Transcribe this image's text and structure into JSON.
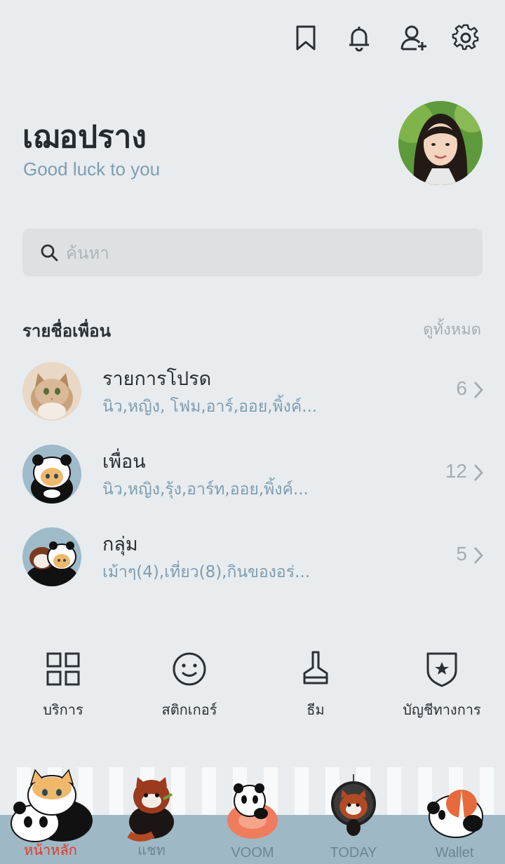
{
  "header": {
    "icons": [
      "bookmark-icon",
      "bell-icon",
      "add-friend-icon",
      "gear-icon"
    ]
  },
  "profile": {
    "name": "เฌอปราง",
    "status": "Good luck to you"
  },
  "search": {
    "placeholder": "ค้นหา"
  },
  "friends_section": {
    "heading": "รายชื่อเพื่อน",
    "see_all": "ดูทั้งหมด",
    "rows": [
      {
        "title": "รายการโปรด",
        "subtitle": "นิว,หญิง, โฟม,อาร์,ออย,พิ้งค์...",
        "count": "6"
      },
      {
        "title": "เพื่อน",
        "subtitle": "นิว,หญิง,รุ้ง,อาร์ท,ออย,พิ้งค์...",
        "count": "12"
      },
      {
        "title": "กลุ่ม",
        "subtitle": "เม้าๆ(4),เที่ยว(8),กินของอร่...",
        "count": "5"
      }
    ]
  },
  "services": [
    {
      "label": "บริการ",
      "icon": "grid-icon"
    },
    {
      "label": "สติกเกอร์",
      "icon": "smiley-icon"
    },
    {
      "label": "ธีม",
      "icon": "brush-icon"
    },
    {
      "label": "บัญชีทางการ",
      "icon": "shield-star-icon"
    }
  ],
  "tabs": [
    {
      "label": "หน้าหลัก",
      "active": true
    },
    {
      "label": "แชท",
      "active": false
    },
    {
      "label": "VOOM",
      "active": false
    },
    {
      "label": "TODAY",
      "active": false
    },
    {
      "label": "Wallet",
      "active": false
    }
  ],
  "colors": {
    "background": "#e8ecee",
    "accent_blue": "#7f9db0",
    "active_tab": "#e23b2d",
    "tab_base": "#9fb8c5"
  }
}
